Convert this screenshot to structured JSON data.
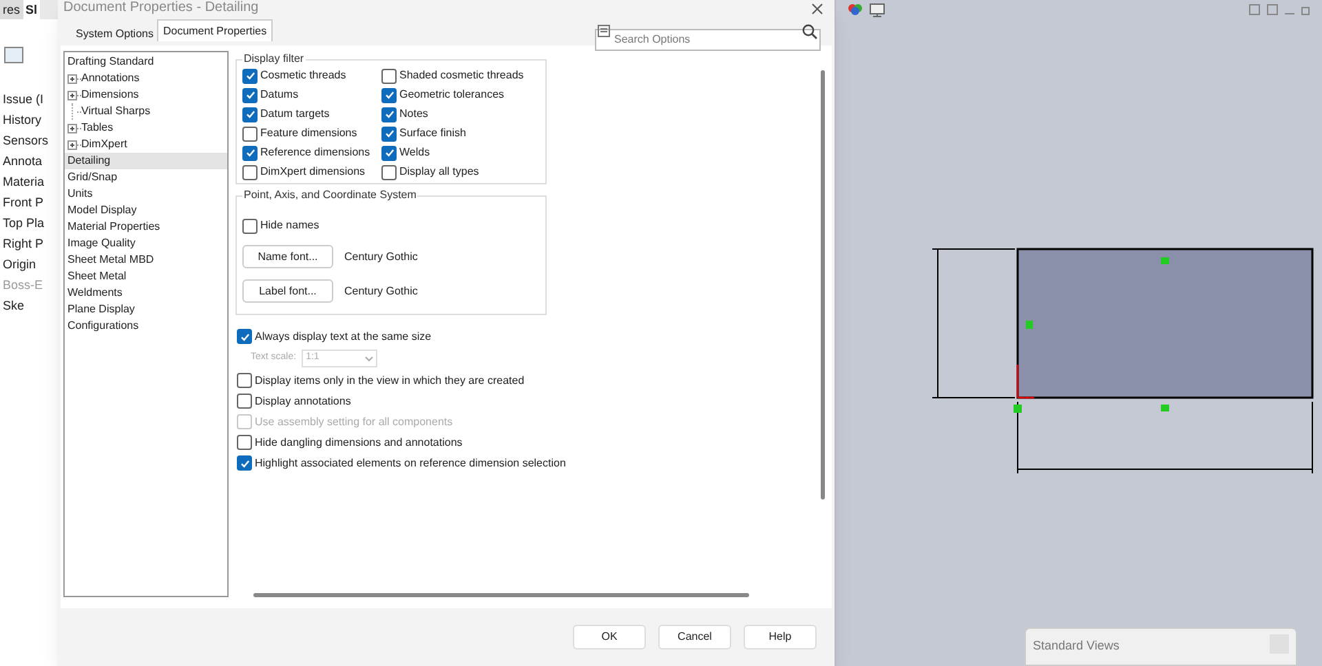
{
  "feature_tree": {
    "tabs": [
      {
        "label": "res",
        "selected": false
      },
      {
        "label": "Sl",
        "selected": true
      }
    ],
    "items": [
      {
        "label": "Issue (I",
        "disabled": false
      },
      {
        "label": "History",
        "disabled": false
      },
      {
        "label": "Sensors",
        "disabled": false
      },
      {
        "label": "Annota",
        "disabled": false
      },
      {
        "label": "Materia",
        "disabled": false
      },
      {
        "label": "Front P",
        "disabled": false
      },
      {
        "label": "Top Pla",
        "disabled": false
      },
      {
        "label": "Right P",
        "disabled": false
      },
      {
        "label": "Origin",
        "disabled": false
      },
      {
        "label": "Boss-E",
        "disabled": true
      },
      {
        "label": "Ske",
        "disabled": false
      }
    ]
  },
  "dialog": {
    "title": "Document Properties - Detailing",
    "tabs": [
      {
        "label": "System Options",
        "selected": false
      },
      {
        "label": "Document Properties",
        "selected": true
      }
    ],
    "search": {
      "placeholder": "Search Options"
    },
    "tree": [
      {
        "label": "Drafting Standard",
        "selected": false,
        "children": [
          {
            "label": "Annotations",
            "selected": false,
            "expanded": false
          },
          {
            "label": "Dimensions",
            "selected": false,
            "expanded": false
          },
          {
            "label": "Virtual Sharps",
            "selected": false
          },
          {
            "label": "Tables",
            "selected": false,
            "expanded": false
          },
          {
            "label": "DimXpert",
            "selected": false,
            "expanded": false
          }
        ]
      },
      {
        "label": "Detailing",
        "selected": true
      },
      {
        "label": "Grid/Snap",
        "selected": false
      },
      {
        "label": "Units",
        "selected": false
      },
      {
        "label": "Model Display",
        "selected": false
      },
      {
        "label": "Material Properties",
        "selected": false
      },
      {
        "label": "Image Quality",
        "selected": false
      },
      {
        "label": "Sheet Metal MBD",
        "selected": false
      },
      {
        "label": "Sheet Metal",
        "selected": false
      },
      {
        "label": "Weldments",
        "selected": false
      },
      {
        "label": "Plane Display",
        "selected": false
      },
      {
        "label": "Configurations",
        "selected": false
      }
    ],
    "display_filter": {
      "title": "Display filter",
      "options": [
        {
          "label": "Cosmetic threads",
          "checked": true
        },
        {
          "label": "Shaded cosmetic threads",
          "checked": false
        },
        {
          "label": "Datums",
          "checked": true
        },
        {
          "label": "Geometric tolerances",
          "checked": true
        },
        {
          "label": "Datum targets",
          "checked": true
        },
        {
          "label": "Notes",
          "checked": true
        },
        {
          "label": "Feature dimensions",
          "checked": false
        },
        {
          "label": "Surface finish",
          "checked": true
        },
        {
          "label": "Reference dimensions",
          "checked": true
        },
        {
          "label": "Welds",
          "checked": true
        },
        {
          "label": "DimXpert dimensions",
          "checked": false
        },
        {
          "label": "Display all types",
          "checked": false
        }
      ]
    },
    "point_axis": {
      "title": "Point, Axis, and Coordinate System",
      "hide_names": {
        "label": "Hide names",
        "checked": false
      },
      "fonts": [
        {
          "button": "Name font...",
          "value": "Century Gothic"
        },
        {
          "button": "Label font...",
          "value": "Century Gothic"
        }
      ]
    },
    "settings": [
      {
        "kind": "checkbox",
        "label": "Always display text at the same size",
        "checked": true,
        "disabled": false
      },
      {
        "kind": "dropdown",
        "label": "Text scale:",
        "value": "1:1",
        "disabled": true
      },
      {
        "kind": "checkbox",
        "label": "Display items only in the view in which they are created",
        "checked": false,
        "disabled": false
      },
      {
        "kind": "checkbox",
        "label": "Display annotations",
        "checked": false,
        "disabled": false
      },
      {
        "kind": "checkbox",
        "label": "Use assembly setting for all components",
        "checked": false,
        "disabled": true
      },
      {
        "kind": "checkbox",
        "label": "Hide dangling dimensions and annotations",
        "checked": false,
        "disabled": false
      },
      {
        "kind": "checkbox",
        "label": "Highlight associated elements on reference dimension selection",
        "checked": true,
        "disabled": false
      }
    ],
    "buttons": [
      "OK",
      "Cancel",
      "Help"
    ]
  },
  "standard_views": {
    "title": "Standard Views"
  }
}
